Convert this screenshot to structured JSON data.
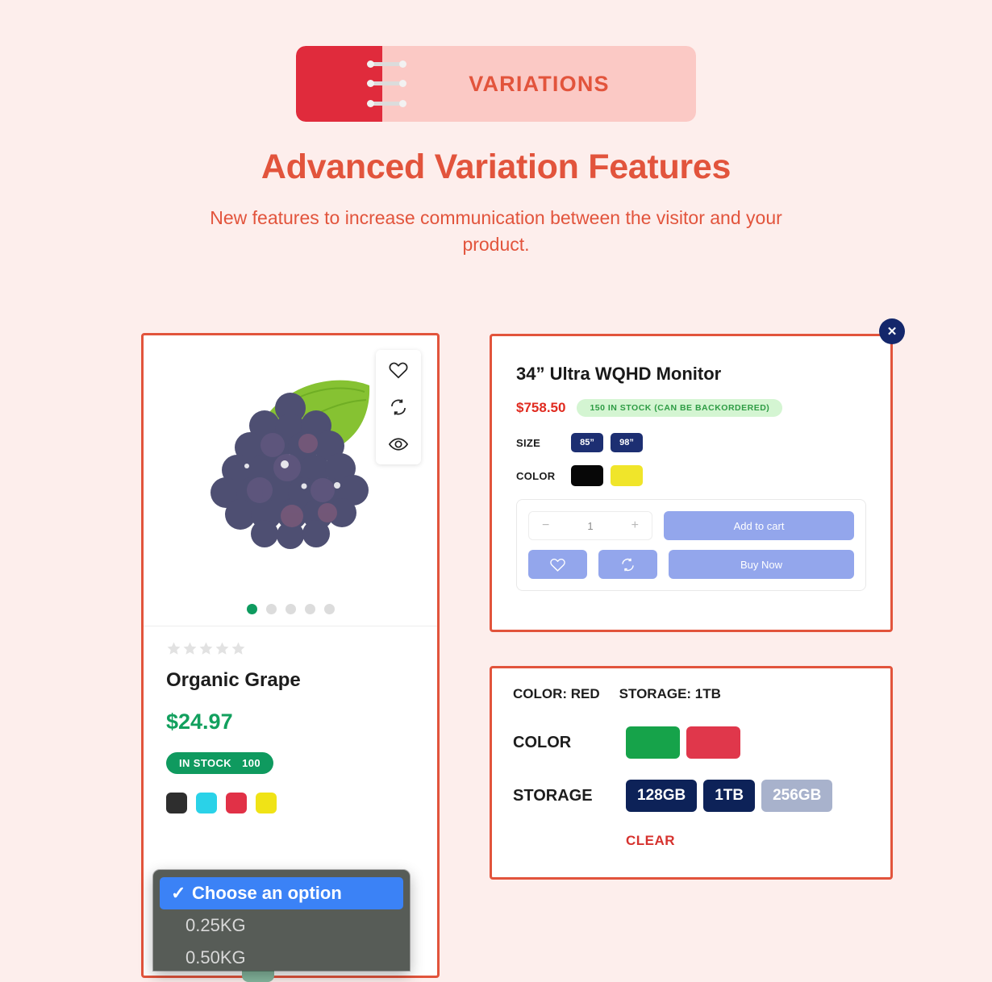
{
  "theme": {
    "page_bg": "#fdeeec",
    "accent": "#e2543c",
    "ribbon_red": "#e02b3c",
    "ribbon_pink": "#fbc9c5",
    "navy": "#14276b",
    "green": "#12a05e"
  },
  "header": {
    "badge_label": "VARIATIONS",
    "title": "Advanced Variation Features",
    "subtitle": "New features to increase communication between the visitor and your product."
  },
  "product_card": {
    "gallery": {
      "actions": [
        {
          "name": "wishlist-icon",
          "label": "heart-icon"
        },
        {
          "name": "compare-icon",
          "label": "compare-icon"
        },
        {
          "name": "quickview-icon",
          "label": "eye-icon"
        }
      ],
      "dots_total": 5,
      "active_dot": 1
    },
    "rating_stars": 5,
    "rating_filled": 0,
    "name": "Organic Grape",
    "price": "$24.97",
    "stock_label": "IN STOCK",
    "stock_count": "100",
    "color_swatches": [
      "#2e2e2e",
      "#2ad2e8",
      "#e13147",
      "#f0e316"
    ]
  },
  "dropdown": {
    "options": [
      {
        "label": "Choose an option",
        "selected": true,
        "check": "✓"
      },
      {
        "label": "0.25KG",
        "selected": false,
        "check": ""
      },
      {
        "label": "0.50KG",
        "selected": false,
        "check": ""
      }
    ]
  },
  "monitor_card": {
    "close_label": "✕",
    "title": "34” Ultra WQHD Monitor",
    "price": "$758.50",
    "stock_badge": "150 IN STOCK (CAN BE BACKORDERED)",
    "attributes": [
      {
        "label": "SIZE",
        "type": "text",
        "options": [
          {
            "label": "85”",
            "color": "#1d2f72"
          },
          {
            "label": "98”",
            "color": "#1d2f72"
          }
        ]
      },
      {
        "label": "COLOR",
        "type": "color",
        "options": [
          {
            "label": "Black",
            "color": "#070707"
          },
          {
            "label": "Yellow",
            "color": "#f0e52a"
          }
        ]
      }
    ],
    "qty": {
      "minus": "−",
      "value": "1",
      "plus": "+"
    },
    "add_to_cart_label": "Add to cart",
    "buy_now_label": "Buy Now",
    "wishlist_icon": "heart-icon",
    "compare_icon": "compare-icon"
  },
  "variation_card": {
    "summary": [
      "COLOR: RED",
      "STORAGE: 1TB"
    ],
    "rows": [
      {
        "label": "COLOR",
        "type": "color",
        "options": [
          {
            "label": "Green",
            "color": "#16a34a",
            "state": "available"
          },
          {
            "label": "Red",
            "color": "#e0374b",
            "state": "selected"
          }
        ]
      },
      {
        "label": "STORAGE",
        "type": "text",
        "options": [
          {
            "label": "128GB",
            "color": "#0d2258",
            "state": "available"
          },
          {
            "label": "1TB",
            "color": "#0d2258",
            "state": "selected"
          },
          {
            "label": "256GB",
            "color": "#a8b2cc",
            "state": "disabled"
          }
        ]
      }
    ],
    "clear_label": "CLEAR"
  }
}
